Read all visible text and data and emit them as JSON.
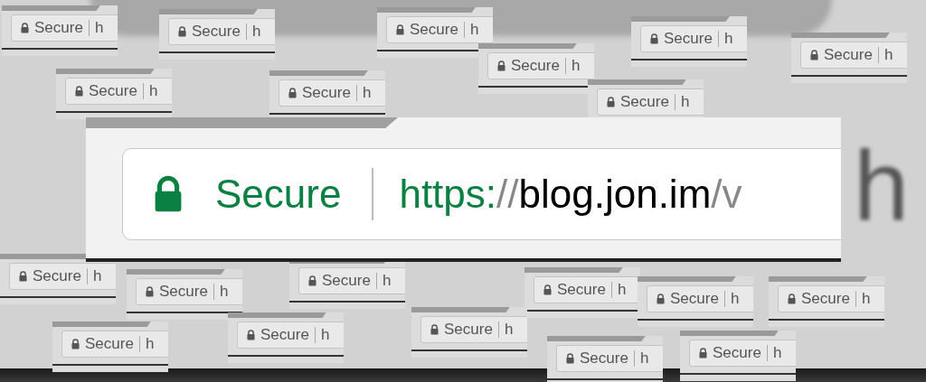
{
  "background_text": "h",
  "tiles": [
    {
      "security_label": "Secure",
      "url": "h"
    },
    {
      "security_label": "Secure",
      "url": "h"
    },
    {
      "security_label": "Secure",
      "url": "h"
    },
    {
      "security_label": "Secure",
      "url": "h"
    },
    {
      "security_label": "Secure",
      "url": "h"
    },
    {
      "security_label": "Secure",
      "url": "h"
    },
    {
      "security_label": "Secure",
      "url": "h"
    },
    {
      "security_label": "Secure",
      "url": "h"
    },
    {
      "security_label": "Secure",
      "url": "h"
    },
    {
      "security_label": "Secure",
      "url": "h"
    },
    {
      "security_label": "Secure",
      "url": "h"
    },
    {
      "security_label": "Secure",
      "url": "h"
    },
    {
      "security_label": "Secure",
      "url": "h"
    },
    {
      "security_label": "Secure",
      "url": "h"
    },
    {
      "security_label": "Secure",
      "url": "h"
    },
    {
      "security_label": "Secure",
      "url": "h"
    },
    {
      "security_label": "Secure",
      "url": "h"
    },
    {
      "security_label": "Secure",
      "url": "h"
    },
    {
      "security_label": "Secure",
      "url": "h"
    },
    {
      "security_label": "Secure",
      "url": "h"
    }
  ],
  "main_bar": {
    "security_label": "Secure",
    "url": [
      {
        "kind": "scheme",
        "text": "https:"
      },
      {
        "kind": "separator",
        "text": "//"
      },
      {
        "kind": "host",
        "text": "blog.jon.im"
      },
      {
        "kind": "path",
        "text": "/v"
      }
    ]
  }
}
